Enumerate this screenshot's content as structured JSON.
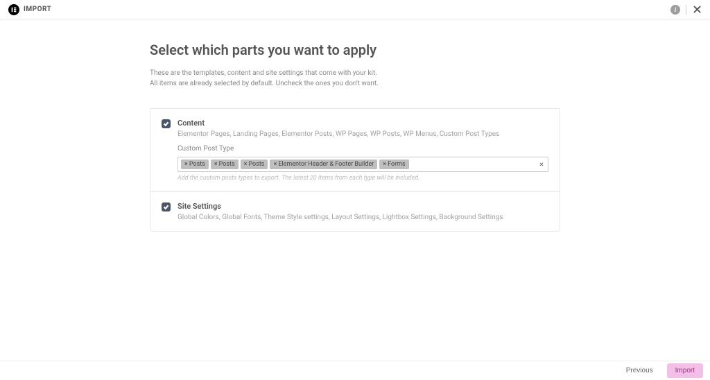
{
  "topbar": {
    "title": "IMPORT"
  },
  "heading": "Select which parts you want to apply",
  "description_line1": "These are the templates, content and site settings that come with your kit.",
  "description_line2": "All items are already selected by default. Uncheck the ones you don't want.",
  "sections": {
    "content": {
      "checked": true,
      "title": "Content",
      "subtitle": "Elementor Pages, Landing Pages, Elementor Posts, WP Pages, WP Posts, WP Menus, Custom Post Types",
      "cpt_label": "Custom Post Type",
      "tags": [
        "Posts",
        "Posts",
        "Posts",
        "Elementor Header &amp; Footer Builder",
        "Forms"
      ],
      "hint": "Add the custom posts types to export. The latest 20 items from each type will be included."
    },
    "site_settings": {
      "checked": true,
      "title": "Site Settings",
      "subtitle": "Global Colors, Global Fonts, Theme Style settings, Layout Settings, Lightbox Settings, Background Settings"
    }
  },
  "footer": {
    "previous": "Previous",
    "import": "Import"
  }
}
